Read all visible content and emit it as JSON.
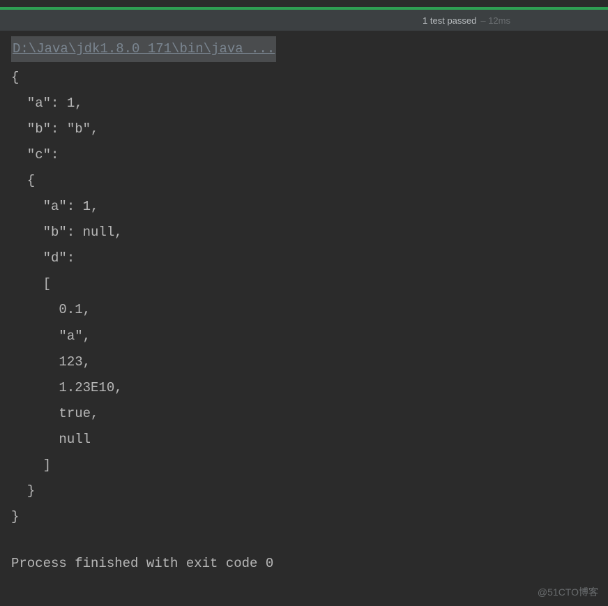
{
  "status": {
    "passed_text": "1 test passed",
    "time_text": "– 12ms"
  },
  "console": {
    "java_path": "D:\\Java\\jdk1.8.0_171\\bin\\java ...",
    "lines": [
      "{",
      "  \"a\": 1,",
      "  \"b\": \"b\",",
      "  \"c\":",
      "  {",
      "    \"a\": 1,",
      "    \"b\": null,",
      "    \"d\":",
      "    [",
      "      0.1,",
      "      \"a\",",
      "      123,",
      "      1.23E10,",
      "      true,",
      "      null",
      "    ]",
      "  }",
      "}"
    ],
    "process_exit": "Process finished with exit code 0"
  },
  "watermark": "@51CTO博客"
}
